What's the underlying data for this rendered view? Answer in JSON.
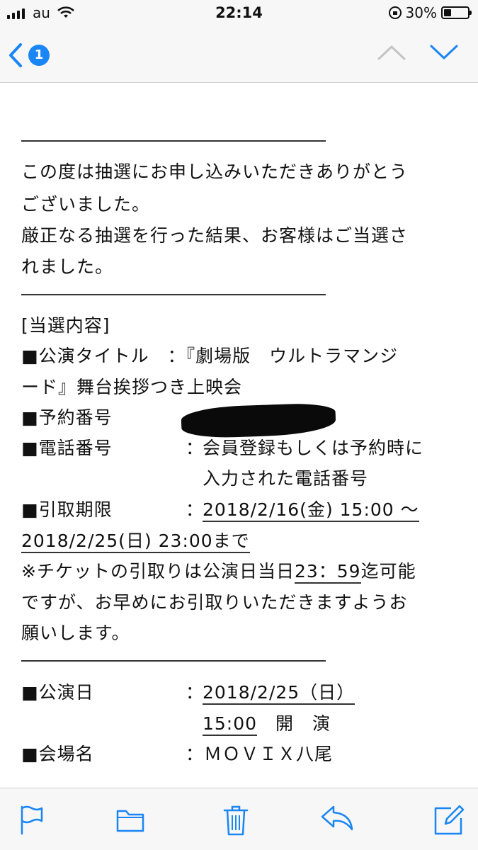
{
  "status": {
    "carrier": "au",
    "time": "22:14",
    "battery": "30%",
    "battery_level": 0.3
  },
  "nav": {
    "unread_count": "1"
  },
  "email": {
    "intro": [
      "この度は抽選にお申し込みいただきありがとう",
      "ございました。",
      "厳正なる抽選を行った結果、お客様はご当選さ",
      "れました。"
    ],
    "section_heading": "[当選内容]",
    "title_label": "■公演タイトル　：『劇場版　ウルトラマンジ",
    "title_cont": "ード』舞台挨拶つき上映会",
    "reservation_label": "■予約番号",
    "phone_label": "■電話番号",
    "phone_sep": "：",
    "phone_value_1": "会員登録もしくは予約時に",
    "phone_value_2": "入力された電話番号",
    "pickup_label": "■引取期限",
    "pickup_sep": "：",
    "pickup_start": "2018/2/16(金) 15:00 ～",
    "pickup_end": "2018/2/25(日) 23:00まで",
    "note_1a": "※チケットの引取りは公演日当日",
    "note_1b": "23：59",
    "note_1c": "迄可能",
    "note_2": "ですが、お早めにお引取りいただきますようお",
    "note_3": "願いします。",
    "perf_date_label": "■公演日",
    "perf_date_sep": "：",
    "perf_date": "2018/2/25（日）",
    "perf_time": "15:00",
    "perf_time_suffix": "　開　演",
    "venue_label": "■会場名",
    "venue_value": "：ＭＯＶＩＸ八尾"
  },
  "colors": {
    "accent": "#1a86f5",
    "background": "#f7f7f7",
    "mail_bg": "#ffffff"
  },
  "toolbar": {
    "icons": [
      "flag-icon",
      "folder-icon",
      "trash-icon",
      "reply-icon",
      "compose-icon"
    ]
  }
}
